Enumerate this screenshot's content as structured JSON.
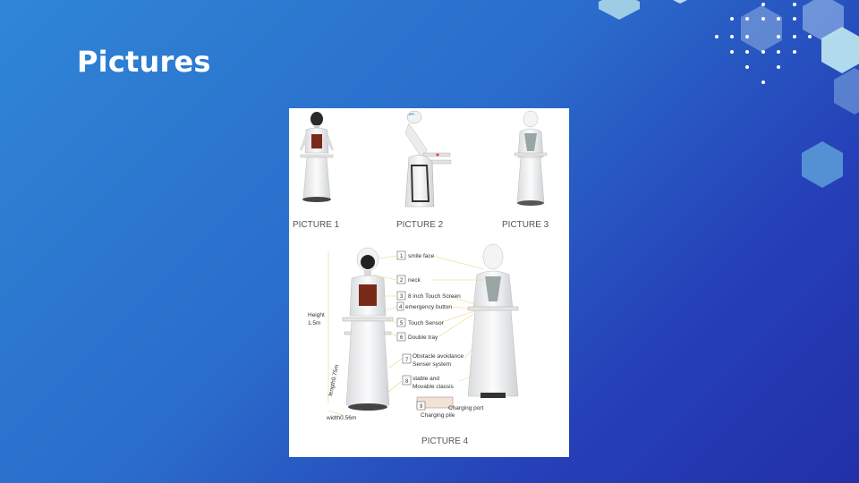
{
  "slide": {
    "title": "Pictures",
    "colors": {
      "bg_start": "#2f86d6",
      "bg_end": "#2230a8",
      "accent_hex": "#a9d8e8"
    }
  },
  "figure": {
    "captions": [
      "PICTURE 1",
      "PICTURE 2",
      "PICTURE 3",
      "PICTURE 4"
    ],
    "callouts": [
      {
        "n": "1",
        "text": "smile face"
      },
      {
        "n": "2",
        "text": "neck"
      },
      {
        "n": "3",
        "text": "8 inch Touch Screen"
      },
      {
        "n": "4",
        "text": "emergency button"
      },
      {
        "n": "5",
        "text": "Touch Sensor"
      },
      {
        "n": "6",
        "text": "Double tray"
      },
      {
        "n": "7",
        "text": "Obstacle avoidance"
      },
      {
        "n": "8",
        "text": "stable and"
      },
      {
        "n": "9",
        "text": "Charging port"
      }
    ],
    "callout_extra": {
      "senser": "Senser system",
      "movable": "Movable classis",
      "pile": "Charging pile"
    },
    "dimensions": {
      "height_label": "Height",
      "height_value": "1.5m",
      "length": "length0.75m",
      "width": "width0.56m"
    }
  }
}
